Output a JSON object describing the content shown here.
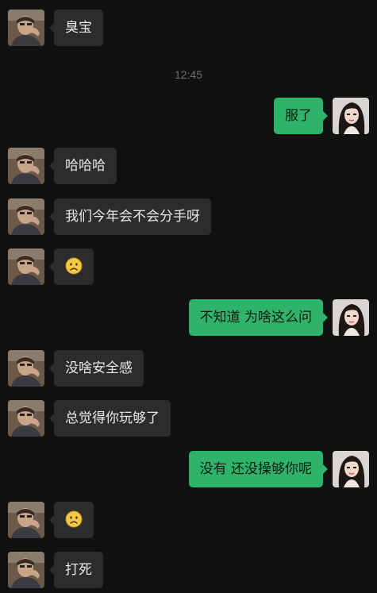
{
  "chat": {
    "timestamp": "12:45",
    "messages": [
      {
        "sender": "other",
        "text": "臭宝"
      },
      {
        "sender": "me",
        "text": "服了"
      },
      {
        "sender": "other",
        "text": "哈哈哈"
      },
      {
        "sender": "other",
        "text": "我们今年会不会分手呀"
      },
      {
        "sender": "other",
        "emoji": "frowning-face"
      },
      {
        "sender": "me",
        "text": "不知道 为啥这么问"
      },
      {
        "sender": "other",
        "text": "没啥安全感"
      },
      {
        "sender": "other",
        "text": "总觉得你玩够了"
      },
      {
        "sender": "me",
        "text": "没有 还没操够你呢"
      },
      {
        "sender": "other",
        "emoji": "frowning-face"
      },
      {
        "sender": "other",
        "text": "打死"
      }
    ]
  },
  "colors": {
    "background": "#111111",
    "incoming_bubble": "#2c2c2c",
    "outgoing_bubble": "#2fb36a",
    "timestamp": "#6d6d6d"
  }
}
